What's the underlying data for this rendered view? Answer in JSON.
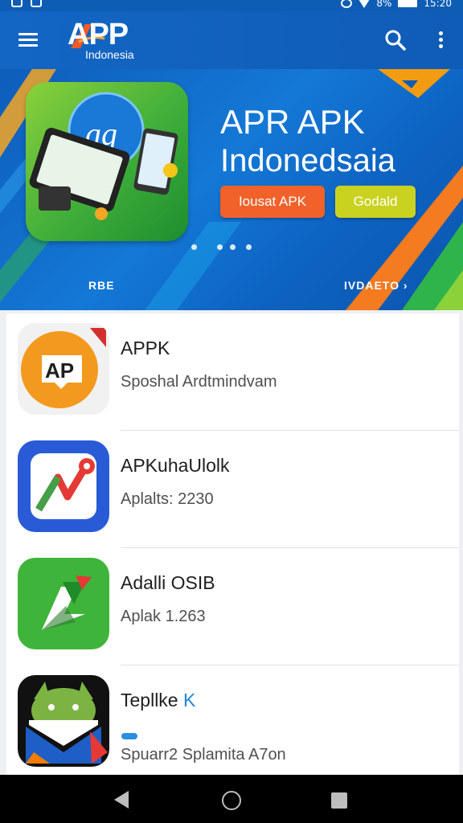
{
  "status_bar": {
    "battery_percent": "8%",
    "time": "15:20"
  },
  "app_bar": {
    "logo_text": "APP",
    "logo_sub": "Indonesia",
    "icons": [
      "menu-icon",
      "search-icon",
      "more-vert-icon"
    ]
  },
  "banner": {
    "title_line1": "APR APK",
    "title_line2": "Indonedsaia",
    "primary_button": "Iousat APK",
    "secondary_button": "Godald",
    "left_label": "RBE",
    "right_link": "IVDAETO",
    "page_count": 4,
    "colors": {
      "orange": "#f0622a",
      "yellow": "#c9d21f",
      "blue": "#1366c4",
      "green": "#3fae3a"
    }
  },
  "apps": [
    {
      "name": "APPK",
      "subtitle": "Sposhal Ardtmindvam",
      "icon": "apk-badge-icon"
    },
    {
      "name": "APKuhaUlolk",
      "subtitle": "Aplalts: 2230",
      "icon": "trend-arrow-icon"
    },
    {
      "name": "Adalli OSIB",
      "subtitle": "Aplak 1.263",
      "icon": "green-arrow-icon"
    },
    {
      "name_main": "Tepllke",
      "name_accent": "K",
      "subtitle": "Spuarr2 Splamita A7on",
      "icon": "android-mail-icon"
    }
  ],
  "nav_bar": {
    "icons": [
      "back-icon",
      "home-icon",
      "recents-icon"
    ]
  }
}
